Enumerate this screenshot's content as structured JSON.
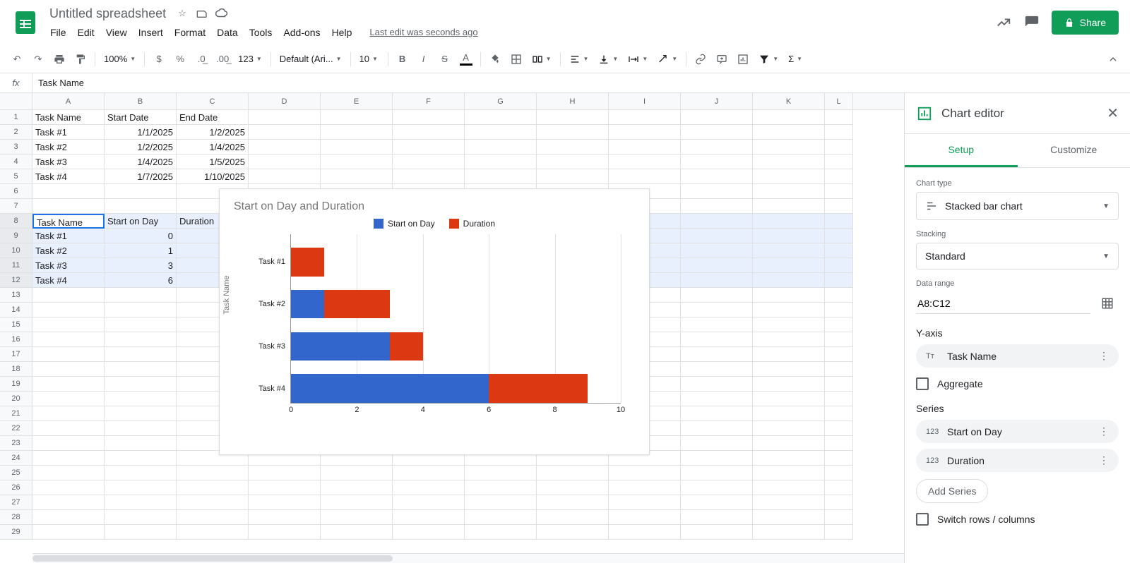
{
  "header": {
    "title": "Untitled spreadsheet",
    "menubar": [
      "File",
      "Edit",
      "View",
      "Insert",
      "Format",
      "Data",
      "Tools",
      "Add-ons",
      "Help"
    ],
    "last_edit": "Last edit was seconds ago",
    "share": "Share"
  },
  "toolbar": {
    "zoom": "100%",
    "font": "Default (Ari...",
    "font_size": "10",
    "num_format": "123"
  },
  "formula_bar": {
    "fx": "fx",
    "value": "Task Name"
  },
  "columns": [
    "A",
    "B",
    "C",
    "D",
    "E",
    "F",
    "G",
    "H",
    "I",
    "J",
    "K",
    "L"
  ],
  "grid": {
    "headers1": {
      "a": "Task Name",
      "b": "Start Date",
      "c": "End Date"
    },
    "rows1": [
      {
        "a": "Task #1",
        "b": "1/1/2025",
        "c": "1/2/2025"
      },
      {
        "a": "Task #2",
        "b": "1/2/2025",
        "c": "1/4/2025"
      },
      {
        "a": "Task #3",
        "b": "1/4/2025",
        "c": "1/5/2025"
      },
      {
        "a": "Task #4",
        "b": "1/7/2025",
        "c": "1/10/2025"
      }
    ],
    "headers2": {
      "a": "Task Name",
      "b": "Start on Day",
      "c": "Duration"
    },
    "rows2": [
      {
        "a": "Task #1",
        "b": "0"
      },
      {
        "a": "Task #2",
        "b": "1"
      },
      {
        "a": "Task #3",
        "b": "3"
      },
      {
        "a": "Task #4",
        "b": "6"
      }
    ]
  },
  "chart_data": {
    "type": "bar",
    "title": "Start on Day and Duration",
    "ylabel": "Task Name",
    "xlabel": "",
    "xlim": [
      0,
      10
    ],
    "xticks": [
      0,
      2,
      4,
      6,
      8,
      10
    ],
    "categories": [
      "Task #1",
      "Task #2",
      "Task #3",
      "Task #4"
    ],
    "series": [
      {
        "name": "Start on Day",
        "color": "#3366cc",
        "values": [
          0,
          1,
          3,
          6
        ]
      },
      {
        "name": "Duration",
        "color": "#dc3912",
        "values": [
          1,
          2,
          1,
          3
        ]
      }
    ]
  },
  "editor": {
    "title": "Chart editor",
    "tabs": {
      "setup": "Setup",
      "customize": "Customize"
    },
    "chart_type_label": "Chart type",
    "chart_type": "Stacked bar chart",
    "stacking_label": "Stacking",
    "stacking": "Standard",
    "data_range_label": "Data range",
    "data_range": "A8:C12",
    "yaxis_label": "Y-axis",
    "yaxis_value": "Task Name",
    "aggregate": "Aggregate",
    "series_label": "Series",
    "series1": "Start on Day",
    "series2": "Duration",
    "add_series": "Add Series",
    "switch_rows": "Switch rows / columns"
  }
}
